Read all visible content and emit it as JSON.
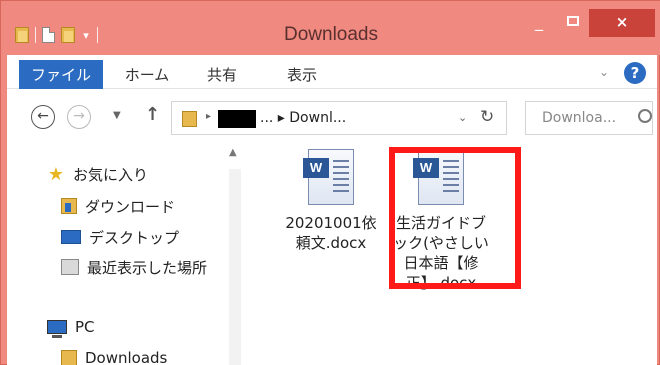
{
  "window": {
    "title": "Downloads",
    "minimize_symbol": "_",
    "close_symbol": "×"
  },
  "ribbon": {
    "file_tab": "ファイル",
    "home_tab": "ホーム",
    "share_tab": "共有",
    "view_tab": "表示",
    "help_symbol": "?"
  },
  "navigation": {
    "back_symbol": "←",
    "forward_symbol": "→",
    "up_symbol": "↑",
    "address_text": "... ▸ Downl...",
    "search_placeholder": "Downloa..."
  },
  "nav_pane": {
    "favorites": "お気に入り",
    "downloads": "ダウンロード",
    "desktop": "デスクトップ",
    "recent": "最近表示した場所",
    "pc": "PC",
    "pc_downloads": "Downloads"
  },
  "files": [
    {
      "name": "20201001依頼文.docx"
    },
    {
      "name": "生活ガイドブック(やさしい日本語【修正】.docx"
    }
  ],
  "colors": {
    "titlebar": "#f08a80",
    "accent": "#2b6cc2",
    "selection_highlight": "#ff1a1a"
  }
}
